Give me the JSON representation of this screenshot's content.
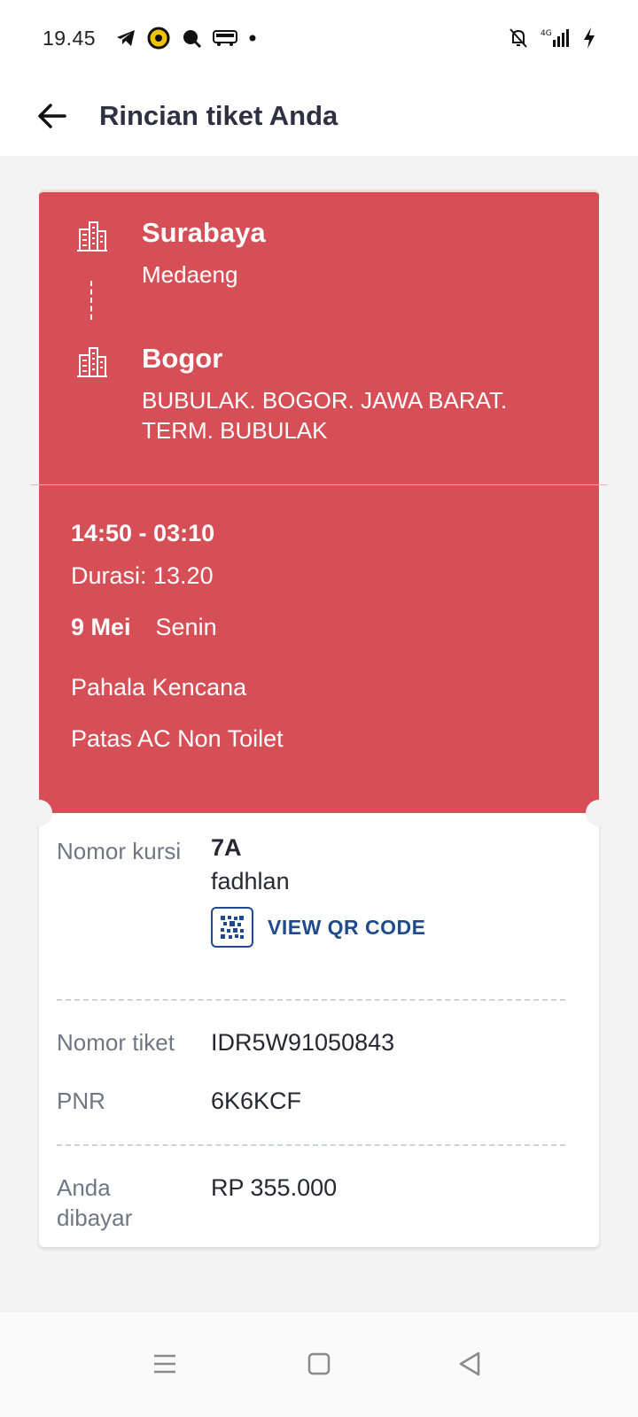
{
  "status_bar": {
    "time": "19.45",
    "network": "4G"
  },
  "header": {
    "title": "Rincian tiket Anda"
  },
  "route": {
    "origin_city": "Surabaya",
    "origin_point": "Medaeng",
    "destination_city": "Bogor",
    "destination_point": "BUBULAK. BOGOR. JAWA BARAT. TERM. BUBULAK"
  },
  "trip": {
    "time_range": "14:50 - 03:10",
    "duration": "Durasi: 13.20",
    "date": "9 Mei",
    "weekday": "Senin",
    "operator": "Pahala Kencana",
    "bus_class": "Patas AC Non Toilet"
  },
  "details": {
    "seat_label": "Nomor kursi",
    "seat_value": "7A",
    "passenger": "fadhlan",
    "qr_button": "VIEW QR CODE",
    "ticket_label": "Nomor tiket",
    "ticket_value": "IDR5W91050843",
    "pnr_label": "PNR",
    "pnr_value": "6K6KCF",
    "paid_label": "Anda dibayar",
    "paid_value": "RP 355.000"
  },
  "colors": {
    "ticket_red": "#d64f56",
    "link_blue": "#1f4b8e",
    "title_dark": "#2f3142"
  }
}
